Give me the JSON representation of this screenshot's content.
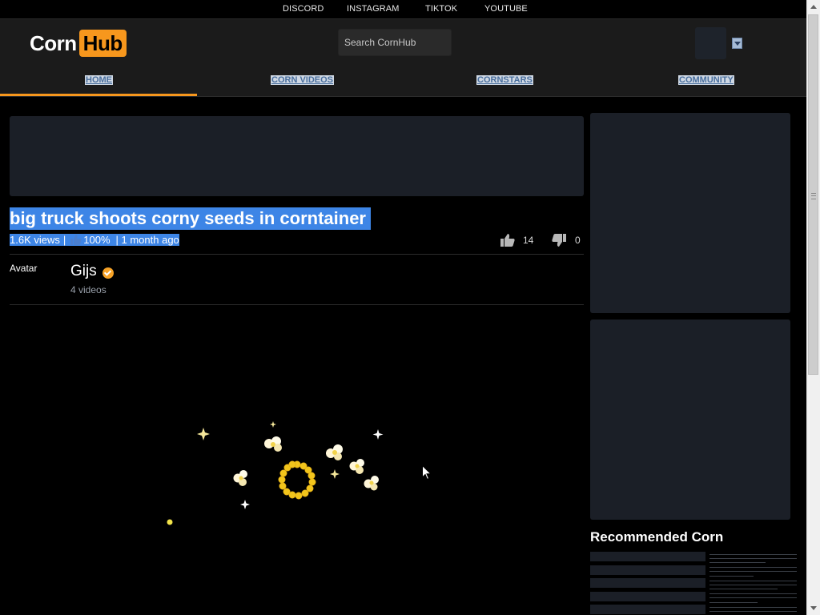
{
  "social_links": [
    "DISCORD",
    "INSTAGRAM",
    "TIKTOK",
    "YOUTUBE"
  ],
  "logo": {
    "part1": "Corn",
    "part2": "Hub"
  },
  "search": {
    "placeholder": "Search CornHub"
  },
  "nav": [
    "HOME",
    "CORN VIDEOS",
    "CORNSTARS",
    "COMMUNITY"
  ],
  "video": {
    "title": "big truck shoots corny seeds in corntainer",
    "views": "1.6K views",
    "separator": "|",
    "rating": "100%",
    "age": "| 1 month ago",
    "likes": "14",
    "dislikes": "0"
  },
  "uploader": {
    "avatar_alt": "Avatar",
    "name": "Gijs",
    "videos": "4 videos"
  },
  "sidebar": {
    "recommended_title": "Recommended Corn"
  },
  "colors": {
    "accent": "#f7971d",
    "selection": "#3d85e6",
    "panel": "#1b1f27"
  }
}
